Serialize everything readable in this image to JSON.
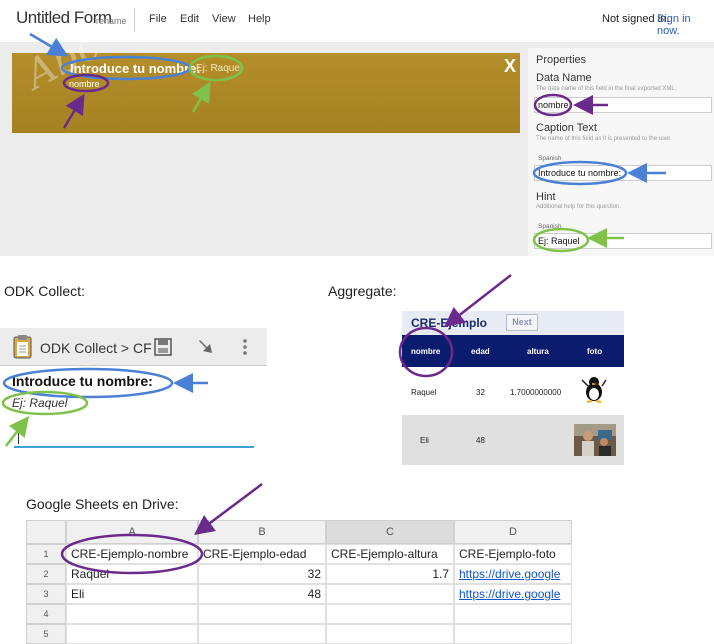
{
  "builder": {
    "form_title": "Untitled Form",
    "rename": "rename",
    "menu": [
      "File",
      "Edit",
      "View",
      "Help"
    ],
    "signin_text": "Not signed in.",
    "signin_link": "Sign in now.",
    "control": {
      "abc": "Abc",
      "caption": "Introduce tu nombre:",
      "name": "nombre",
      "hint": "Ej: Raquel",
      "close": "X"
    },
    "properties": {
      "title": "Properties",
      "data_name_label": "Data Name",
      "data_name_desc": "The data name of this field in the final exported XML.",
      "data_name_value": "nombre",
      "caption_label": "Caption Text",
      "caption_desc": "The name of this field as it is presented to the user.",
      "caption_lang": "Spanish",
      "caption_value": "Introduce tu nombre:",
      "hint_label": "Hint",
      "hint_desc": "Additional help for this question.",
      "hint_lang": "Spanish",
      "hint_value": "Ej: Raquel"
    }
  },
  "odk_collect": {
    "section_label": "ODK Collect:",
    "app_title": "ODK Collect > CF",
    "question": "Introduce tu nombre:",
    "hint": "Ej: Raquel",
    "icons": [
      "clipboard-icon",
      "save-icon",
      "jump-icon",
      "more-vert-icon"
    ]
  },
  "aggregate": {
    "section_label": "Aggregate:",
    "title": "CRE-Ejemplo",
    "next_button": "Next",
    "columns": [
      "nombre",
      "edad",
      "altura",
      "foto"
    ],
    "rows": [
      {
        "nombre": "Raquel",
        "edad": "32",
        "altura": "1.7000000000",
        "foto": "photo-thumbnail"
      },
      {
        "nombre": "Eli",
        "edad": "48",
        "altura": "",
        "foto": "photo-thumbnail"
      }
    ]
  },
  "sheets": {
    "section_label": "Google Sheets en Drive:",
    "columns": [
      "A",
      "B",
      "C",
      "D"
    ],
    "row_numbers": [
      "1",
      "2",
      "3",
      "4",
      "5"
    ],
    "rows": [
      [
        "CRE-Ejemplo-nombre",
        "CRE-Ejemplo-edad",
        "CRE-Ejemplo-altura",
        "CRE-Ejemplo-foto"
      ],
      [
        "Raquel",
        "32",
        "1.7",
        "https://drive.google"
      ],
      [
        "Eli",
        "48",
        "",
        "https://drive.google"
      ],
      [
        "",
        "",
        "",
        ""
      ],
      [
        "",
        "",
        "",
        ""
      ]
    ]
  },
  "colors": {
    "annotation_blue": "#4a80d6",
    "annotation_green": "#7fc24a",
    "annotation_purple": "#6a2a8c",
    "builder_control": "#a68223",
    "aggregate_header": "#0b1b6e"
  }
}
